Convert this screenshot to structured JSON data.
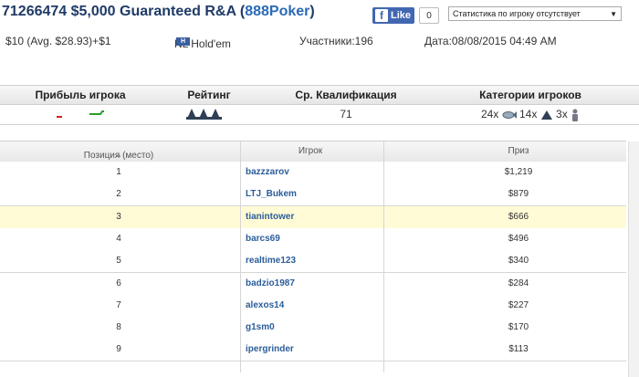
{
  "header": {
    "title_prefix": "71266474 $5,000 Guaranteed R&A (",
    "site_name": "888Poker",
    "title_suffix": ")",
    "fb_like_label": "Like",
    "fb_like_count": "0",
    "stats_select_value": "Статистика по игроку отсутствует"
  },
  "info": {
    "buyin": "$10 (Avg. $28.93)+$1",
    "game": "NL Hold'em",
    "game_badge": "H",
    "participants": "Участники:196",
    "date": "Дата:08/08/2015 04:49 AM"
  },
  "stats": {
    "headers": [
      "Прибыль игрока",
      "Рейтинг",
      "Ср. Квалификация",
      "Категории игроков"
    ],
    "avg_qualification": "71",
    "categories": [
      {
        "count": "24x",
        "icon": "fish-icon"
      },
      {
        "count": "14x",
        "icon": "shark-icon"
      },
      {
        "count": "3x",
        "icon": "player-figure-icon"
      }
    ],
    "colors": {
      "profit_up": "#2a9d2a",
      "profit_down": "#cc2222",
      "rating_icon": "#2f3f55"
    }
  },
  "results": {
    "headers": {
      "position": "Позиция (место)",
      "player": "Игрок",
      "prize": "Приз"
    },
    "highlight_color": "#fffbd6",
    "rows": [
      {
        "pos": "1",
        "player": "bazzzarov",
        "prize": "$1,219"
      },
      {
        "pos": "2",
        "player": "LTJ_Bukem",
        "prize": "$879"
      },
      {
        "pos": "3",
        "player": "tianintower",
        "prize": "$666"
      },
      {
        "pos": "4",
        "player": "barcs69",
        "prize": "$496"
      },
      {
        "pos": "5",
        "player": "realtime123",
        "prize": "$340"
      },
      {
        "pos": "6",
        "player": "badzio1987",
        "prize": "$284"
      },
      {
        "pos": "7",
        "player": "alexos14",
        "prize": "$227"
      },
      {
        "pos": "8",
        "player": "g1sm0",
        "prize": "$170"
      },
      {
        "pos": "9",
        "player": "ipergrinder",
        "prize": "$113"
      }
    ]
  }
}
